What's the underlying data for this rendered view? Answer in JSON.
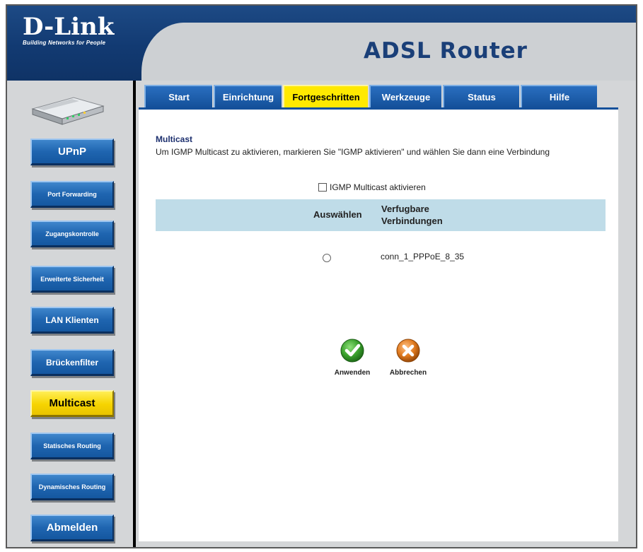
{
  "brand": {
    "logo_text": "D-Link",
    "tagline": "Building Networks for People",
    "product_title": "ADSL Router"
  },
  "sidebar": {
    "items": [
      {
        "label": "UPnP",
        "active": false
      },
      {
        "label": "Port Forwarding",
        "active": false
      },
      {
        "label": "Zugangskontrolle",
        "active": false
      },
      {
        "label": "Erweiterte Sicherheit",
        "active": false
      },
      {
        "label": "LAN Klienten",
        "active": false
      },
      {
        "label": "Brückenfilter",
        "active": false
      },
      {
        "label": "Multicast",
        "active": true
      },
      {
        "label": "Statisches Routing",
        "active": false
      },
      {
        "label": "Dynamisches Routing",
        "active": false
      },
      {
        "label": "Abmelden",
        "active": false
      }
    ]
  },
  "tabs": [
    {
      "label": "Start",
      "active": false
    },
    {
      "label": "Einrichtung",
      "active": false
    },
    {
      "label": "Fortgeschritten",
      "active": true
    },
    {
      "label": "Werkzeuge",
      "active": false
    },
    {
      "label": "Status",
      "active": false
    },
    {
      "label": "Hilfe",
      "active": false
    }
  ],
  "main": {
    "section_title": "Multicast",
    "description": "Um IGMP Multicast zu aktivieren, markieren Sie \"IGMP aktivieren\" und wählen Sie dann eine Verbindung",
    "checkbox_label": "IGMP Multicast aktivieren",
    "checkbox_checked": false,
    "table": {
      "headers": [
        "Auswählen",
        "Verfugbare Verbindungen"
      ],
      "header_conn_line1": "Verfugbare",
      "header_conn_line2": "Verbindungen",
      "rows": [
        {
          "selected": false,
          "connection": "conn_1_PPPoE_8_35"
        }
      ]
    },
    "actions": {
      "apply_label": "Anwenden",
      "cancel_label": "Abbrechen"
    }
  },
  "colors": {
    "header_blue": "#123a72",
    "nav_blue": "#1f65b0",
    "active_yellow": "#ffe900",
    "table_header_bg": "#bfdce8",
    "apply_green": "#3aa12c",
    "cancel_orange": "#e07a1e"
  },
  "icons": {
    "apply": "check-icon",
    "cancel": "x-icon",
    "device": "router-device-icon"
  }
}
